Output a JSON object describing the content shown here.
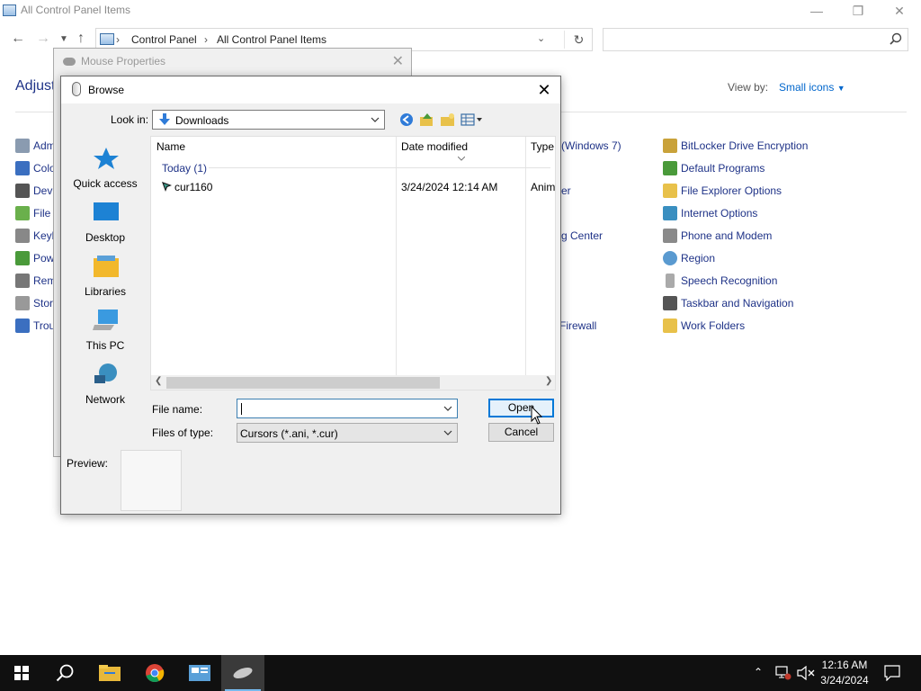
{
  "control_panel": {
    "title": "All Control Panel Items",
    "breadcrumb": [
      "Control Panel",
      "All Control Panel Items"
    ],
    "heading": "Adjust",
    "view_by_label": "View by:",
    "view_by_value": "Small icons",
    "left_items": [
      "Adm",
      "Colo",
      "Devi",
      "File",
      "Keyb",
      "Pow",
      "Rem",
      "Stor",
      "Trou"
    ],
    "mid_items": [
      "(Windows 7)",
      "er",
      "g Center",
      "Firewall"
    ],
    "right_items": [
      "BitLocker Drive Encryption",
      "Default Programs",
      "File Explorer Options",
      "Internet Options",
      "Phone and Modem",
      "Region",
      "Speech Recognition",
      "Taskbar and Navigation",
      "Work Folders"
    ]
  },
  "mouse_properties": {
    "title": "Mouse Properties"
  },
  "browse": {
    "title": "Browse",
    "look_in_label": "Look in:",
    "look_in_value": "Downloads",
    "places": [
      "Quick access",
      "Desktop",
      "Libraries",
      "This PC",
      "Network"
    ],
    "columns": [
      "Name",
      "Date modified",
      "Type"
    ],
    "group_header": "Today (1)",
    "files": [
      {
        "name": "cur1160",
        "date": "3/24/2024 12:14 AM",
        "type": "Anim"
      }
    ],
    "file_name_label": "File name:",
    "file_name_value": "",
    "files_of_type_label": "Files of type:",
    "files_of_type_value": "Cursors (*.ani, *.cur)",
    "open_label": "Open",
    "cancel_label": "Cancel",
    "preview_label": "Preview:"
  },
  "taskbar": {
    "time": "12:16 AM",
    "date": "3/24/2024"
  }
}
